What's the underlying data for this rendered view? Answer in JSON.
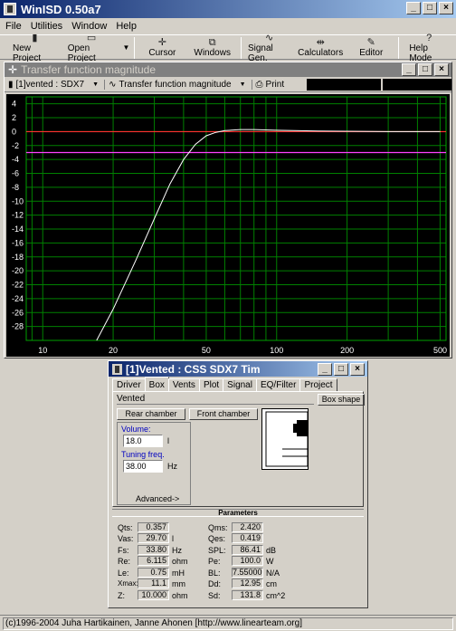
{
  "app": {
    "title": "WinISD 0.50a7"
  },
  "menu": [
    "File",
    "Utilities",
    "Window",
    "Help"
  ],
  "toolbar": [
    {
      "label": "New Project",
      "icon": "new-project-icon",
      "glyph": "▮"
    },
    {
      "label": "Open Project",
      "icon": "open-project-icon",
      "glyph": "▭"
    },
    {
      "label": "Cursor",
      "icon": "cursor-icon",
      "glyph": "✛"
    },
    {
      "label": "Windows",
      "icon": "windows-icon",
      "glyph": "⧉"
    },
    {
      "label": "Signal Gen.",
      "icon": "signal-gen-icon",
      "glyph": "∿"
    },
    {
      "label": "Calculators",
      "icon": "calculators-icon",
      "glyph": "⇹"
    },
    {
      "label": "Editor",
      "icon": "editor-icon",
      "glyph": "✎"
    },
    {
      "label": "Help Mode",
      "icon": "help-mode-icon",
      "glyph": "?"
    }
  ],
  "tf_window": {
    "title": "Transfer function magnitude",
    "project_selector": "[1]vented : SDX7",
    "plot_selector": "Transfer function magnitude",
    "print_label": "Print"
  },
  "chart_data": {
    "type": "line",
    "x_scale": "log",
    "xlim": [
      8.5,
      530
    ],
    "ylim": [
      -30,
      5
    ],
    "x_ticks": [
      10,
      20,
      50,
      100,
      200,
      500
    ],
    "x_tick_labels": [
      "10",
      "20",
      "50",
      "100",
      "200",
      "500"
    ],
    "y_ticks": [
      4,
      2,
      0,
      -2,
      -4,
      -6,
      -8,
      -10,
      -12,
      -14,
      -16,
      -18,
      -20,
      -22,
      -24,
      -26,
      -28
    ],
    "y_tick_labels": [
      "4",
      "2",
      "0",
      "-2",
      "-4",
      "-6",
      "-8",
      "-10",
      "-12",
      "-14",
      "-16",
      "-18",
      "-20",
      "-22",
      "-24",
      "-26",
      "-28"
    ],
    "grid": true,
    "reference_lines": [
      {
        "y": 0,
        "color": "#ff3030"
      },
      {
        "y": -3,
        "color": "#ff40ff"
      }
    ],
    "series": [
      {
        "color": "#ffffff",
        "x": [
          17,
          20,
          25,
          30,
          35,
          40,
          45,
          50,
          55,
          60,
          70,
          80,
          100,
          150,
          200,
          300,
          400,
          500
        ],
        "y": [
          -30,
          -25.5,
          -18.5,
          -12.5,
          -7.5,
          -4,
          -1.8,
          -0.6,
          -0.1,
          0.15,
          0.3,
          0.3,
          0.2,
          0.1,
          0.05,
          0,
          0,
          0
        ]
      }
    ]
  },
  "vented_window": {
    "title": "[1]Vented : CSS SDX7 Tim",
    "tabs": [
      "Driver",
      "Box",
      "Vents",
      "Plot",
      "Signal",
      "EQ/Filter",
      "Project"
    ],
    "box_type": "Vented",
    "box_shape_label": "Box shape",
    "rear_chamber_label": "Rear chamber",
    "front_chamber_label": "Front chamber",
    "volume_label": "Volume:",
    "volume_value": "18.0",
    "volume_unit": "l",
    "tuning_label": "Tuning freq.",
    "tuning_value": "38.00",
    "tuning_unit": "Hz",
    "advanced_label": "Advanced->"
  },
  "parameters": {
    "header": "Parameters",
    "left": [
      {
        "name": "Qts:",
        "value": "0.357",
        "unit": ""
      },
      {
        "name": "Vas:",
        "value": "29.70",
        "unit": "l"
      },
      {
        "name": "Fs:",
        "value": "33.80",
        "unit": "Hz"
      },
      {
        "name": "Re:",
        "value": "6.115",
        "unit": "ohm"
      },
      {
        "name": "Le:",
        "value": "0.75",
        "unit": "mH"
      },
      {
        "name": "Xmax:",
        "value": "11.1",
        "unit": "mm"
      },
      {
        "name": "Z:",
        "value": "10.000",
        "unit": "ohm"
      }
    ],
    "right": [
      {
        "name": "Qms:",
        "value": "2.420",
        "unit": ""
      },
      {
        "name": "Qes:",
        "value": "0.419",
        "unit": ""
      },
      {
        "name": "SPL:",
        "value": "86.41",
        "unit": "dB"
      },
      {
        "name": "Pe:",
        "value": "100.0",
        "unit": "W"
      },
      {
        "name": "BL:",
        "value": "7.55000",
        "unit": "N/A"
      },
      {
        "name": "Dd:",
        "value": "12.95",
        "unit": "cm"
      },
      {
        "name": "Sd:",
        "value": "131.8",
        "unit": "cm^2"
      }
    ]
  },
  "statusbar": "(c)1996-2004 Juha Hartikainen, Janne Ahonen [http://www.linearteam.org]"
}
